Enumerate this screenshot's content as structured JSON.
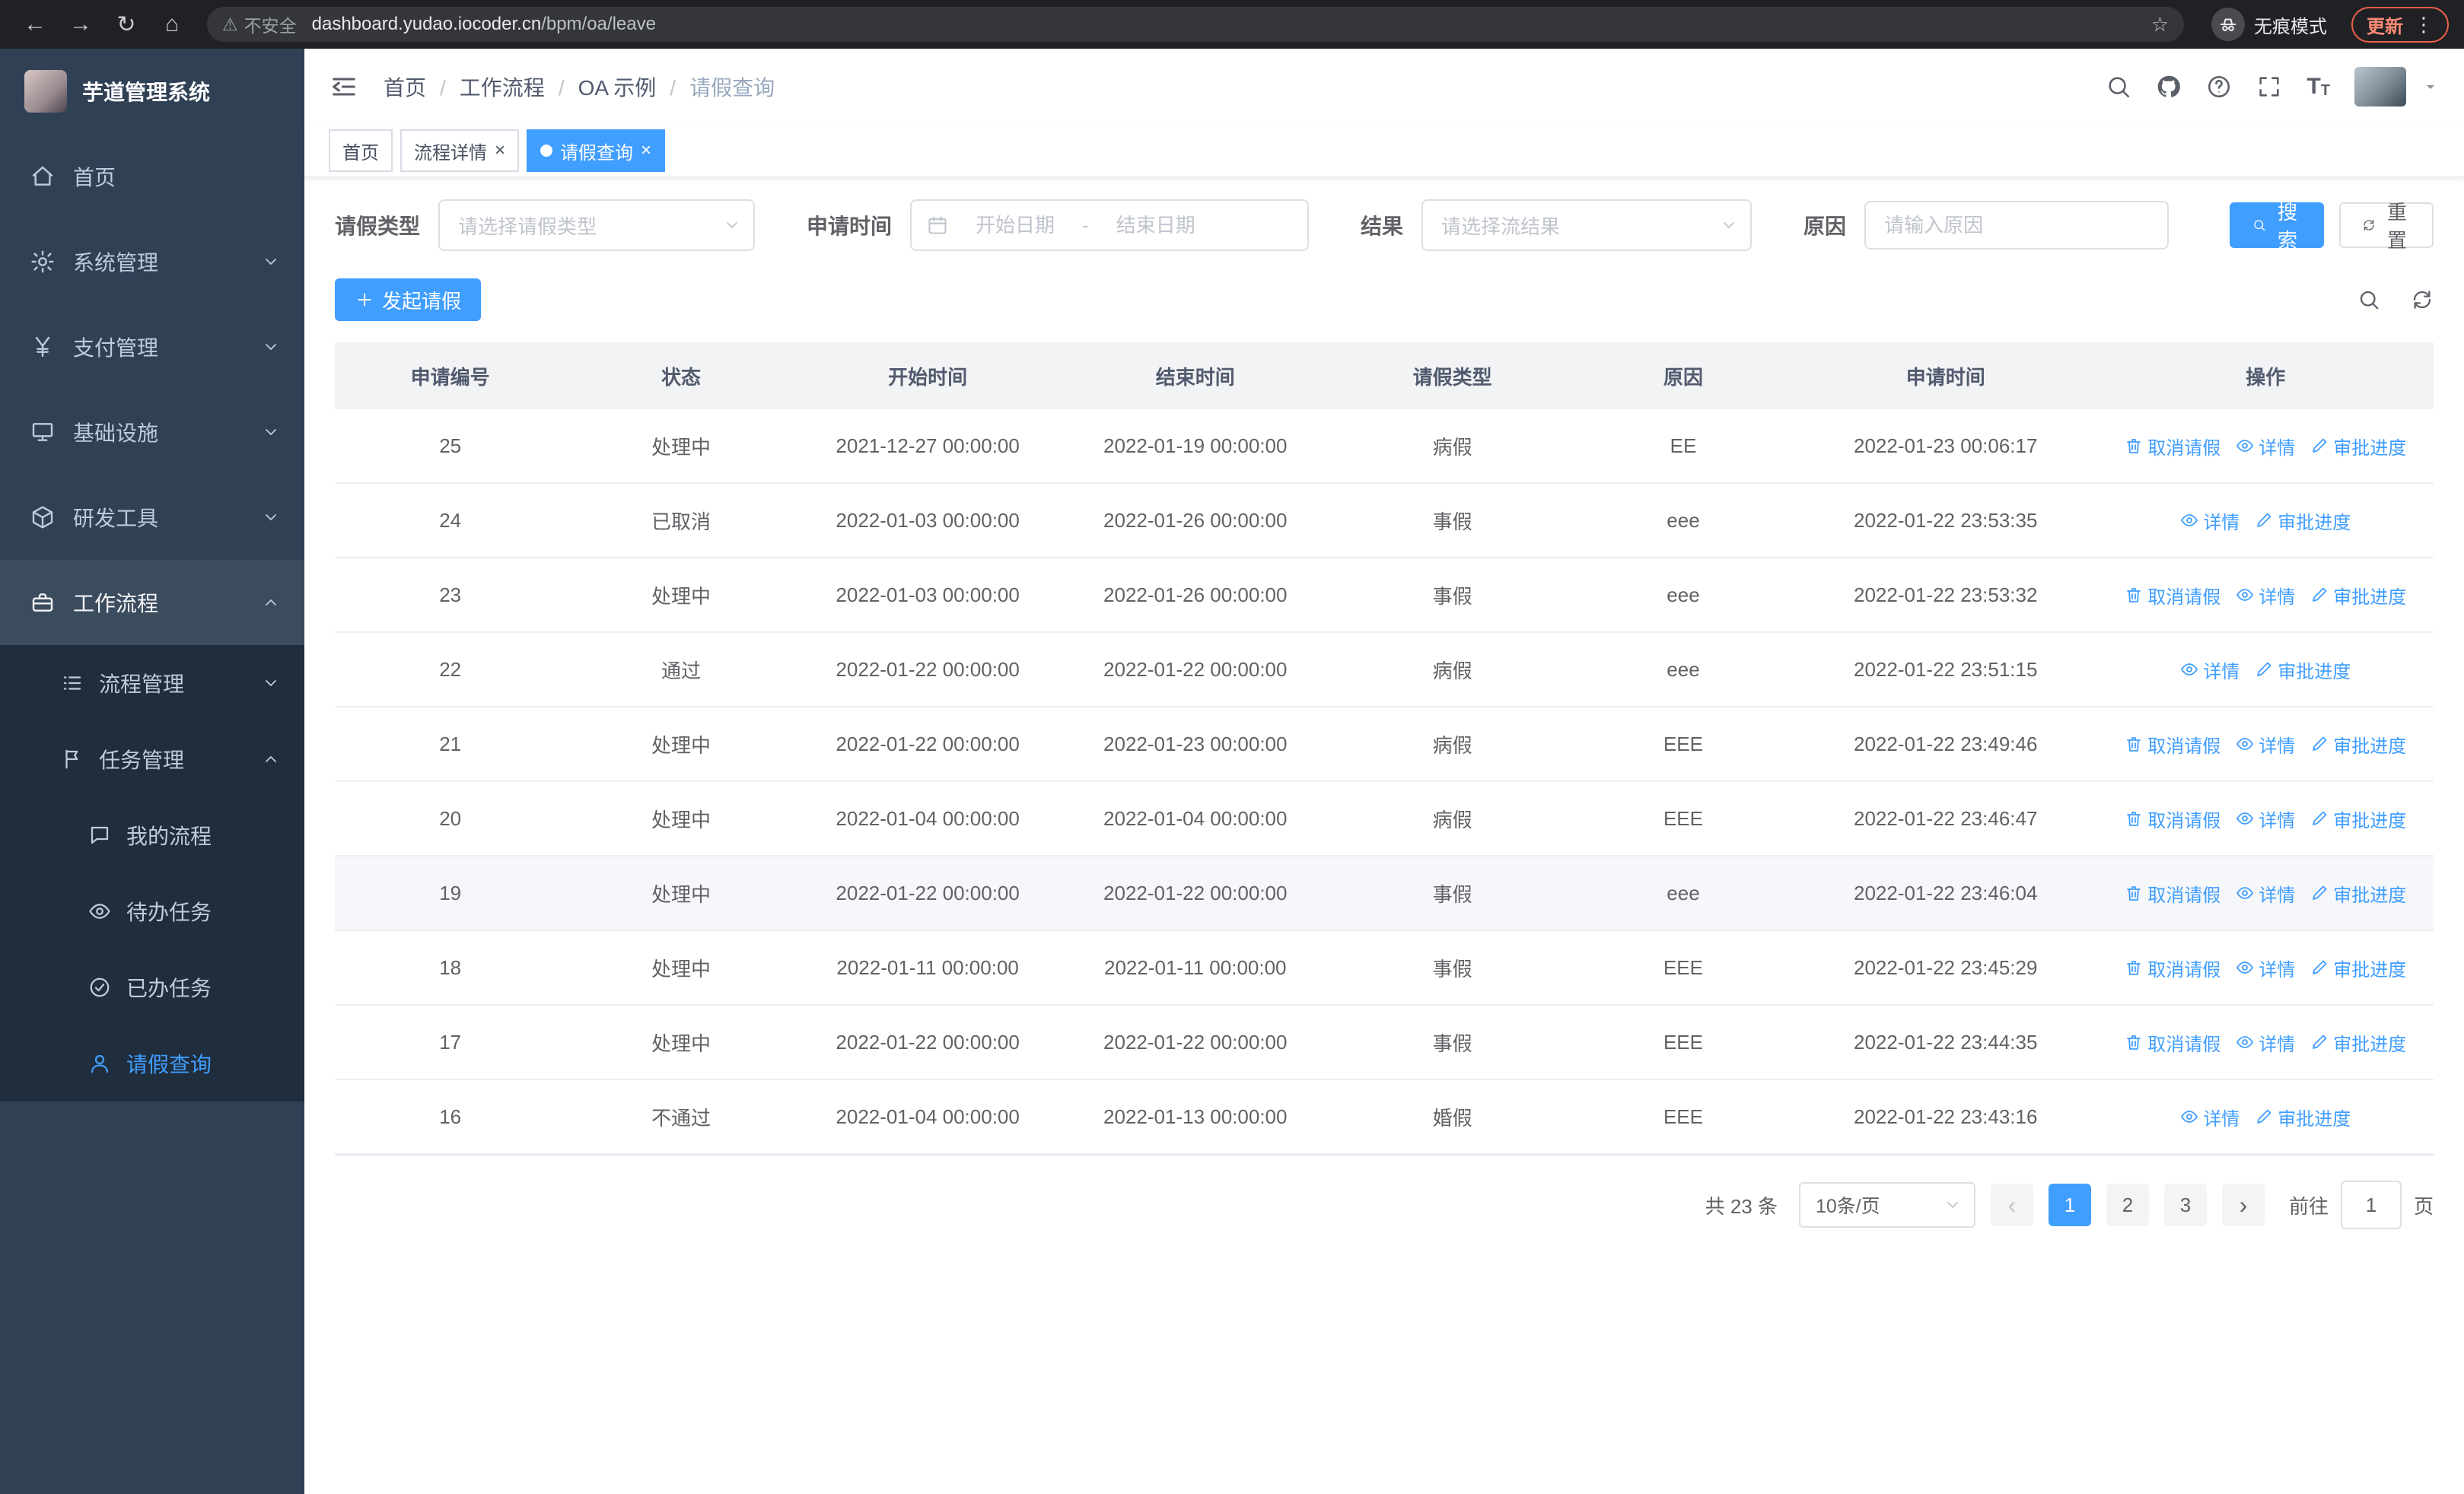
{
  "accent": "#409EFF",
  "browser": {
    "security_label": "不安全",
    "url_domain": "dashboard.yudao.iocoder.cn",
    "url_path": "/bpm/oa/leave",
    "incognito_label": "无痕模式",
    "update_label": "更新"
  },
  "sidebar": {
    "title": "芋道管理系统",
    "top_items": [
      {
        "label": "首页",
        "icon": "home",
        "chevron": false,
        "expanded": false,
        "active_section": false
      },
      {
        "label": "系统管理",
        "icon": "gear",
        "chevron": true,
        "expanded": false,
        "active_section": false
      },
      {
        "label": "支付管理",
        "icon": "yen",
        "chevron": true,
        "expanded": false,
        "active_section": false
      },
      {
        "label": "基础设施",
        "icon": "infra",
        "chevron": true,
        "expanded": false,
        "active_section": false
      },
      {
        "label": "研发工具",
        "icon": "tools",
        "chevron": true,
        "expanded": false,
        "active_section": false
      },
      {
        "label": "工作流程",
        "icon": "workflow",
        "chevron": true,
        "expanded": true,
        "active_section": true
      }
    ],
    "sub_items": [
      {
        "label": "流程管理",
        "icon": "list",
        "chevron": true,
        "expanded": false,
        "child": false,
        "active": false
      },
      {
        "label": "任务管理",
        "icon": "flag",
        "chevron": true,
        "expanded": true,
        "child": false,
        "active": false
      },
      {
        "label": "我的流程",
        "icon": "chat",
        "chevron": false,
        "child": true,
        "active": false
      },
      {
        "label": "待办任务",
        "icon": "eye",
        "chevron": false,
        "child": true,
        "active": false
      },
      {
        "label": "已办任务",
        "icon": "done",
        "chevron": false,
        "child": true,
        "active": false
      },
      {
        "label": "请假查询",
        "icon": "user",
        "chevron": false,
        "child": true,
        "active": true
      }
    ]
  },
  "topbar": {
    "breadcrumb": [
      {
        "label": "首页",
        "current": false
      },
      {
        "label": "工作流程",
        "current": false
      },
      {
        "label": "OA 示例",
        "current": false
      },
      {
        "label": "请假查询",
        "current": true
      }
    ]
  },
  "tabs": [
    {
      "label": "首页",
      "closable": false,
      "active": false
    },
    {
      "label": "流程详情",
      "closable": true,
      "active": false
    },
    {
      "label": "请假查询",
      "closable": true,
      "active": true
    }
  ],
  "filters": {
    "leave_type_label": "请假类型",
    "leave_type_placeholder": "请选择请假类型",
    "apply_time_label": "申请时间",
    "start_date_placeholder": "开始日期",
    "date_separator": "-",
    "end_date_placeholder": "结束日期",
    "result_label": "结果",
    "result_placeholder": "请选择流结果",
    "reason_label": "原因",
    "reason_placeholder": "请输入原因",
    "search_label": "搜索",
    "reset_label": "重置"
  },
  "toolbar": {
    "create_label": "发起请假"
  },
  "table": {
    "columns": [
      "申请编号",
      "状态",
      "开始时间",
      "结束时间",
      "请假类型",
      "原因",
      "申请时间",
      "操作"
    ],
    "action_labels": {
      "cancel": "取消请假",
      "detail": "详情",
      "progress": "审批进度"
    },
    "rows": [
      {
        "id": "25",
        "status": "处理中",
        "start": "2021-12-27 00:00:00",
        "end": "2022-01-19 00:00:00",
        "type": "病假",
        "reason": "EE",
        "time": "2022-01-23 00:06:17",
        "cancel": true,
        "hover": false
      },
      {
        "id": "24",
        "status": "已取消",
        "start": "2022-01-03 00:00:00",
        "end": "2022-01-26 00:00:00",
        "type": "事假",
        "reason": "eee",
        "time": "2022-01-22 23:53:35",
        "cancel": false,
        "hover": false
      },
      {
        "id": "23",
        "status": "处理中",
        "start": "2022-01-03 00:00:00",
        "end": "2022-01-26 00:00:00",
        "type": "事假",
        "reason": "eee",
        "time": "2022-01-22 23:53:32",
        "cancel": true,
        "hover": false
      },
      {
        "id": "22",
        "status": "通过",
        "start": "2022-01-22 00:00:00",
        "end": "2022-01-22 00:00:00",
        "type": "病假",
        "reason": "eee",
        "time": "2022-01-22 23:51:15",
        "cancel": false,
        "hover": false
      },
      {
        "id": "21",
        "status": "处理中",
        "start": "2022-01-22 00:00:00",
        "end": "2022-01-23 00:00:00",
        "type": "病假",
        "reason": "EEE",
        "time": "2022-01-22 23:49:46",
        "cancel": true,
        "hover": false
      },
      {
        "id": "20",
        "status": "处理中",
        "start": "2022-01-04 00:00:00",
        "end": "2022-01-04 00:00:00",
        "type": "病假",
        "reason": "EEE",
        "time": "2022-01-22 23:46:47",
        "cancel": true,
        "hover": false
      },
      {
        "id": "19",
        "status": "处理中",
        "start": "2022-01-22 00:00:00",
        "end": "2022-01-22 00:00:00",
        "type": "事假",
        "reason": "eee",
        "time": "2022-01-22 23:46:04",
        "cancel": true,
        "hover": true
      },
      {
        "id": "18",
        "status": "处理中",
        "start": "2022-01-11 00:00:00",
        "end": "2022-01-11 00:00:00",
        "type": "事假",
        "reason": "EEE",
        "time": "2022-01-22 23:45:29",
        "cancel": true,
        "hover": false
      },
      {
        "id": "17",
        "status": "处理中",
        "start": "2022-01-22 00:00:00",
        "end": "2022-01-22 00:00:00",
        "type": "事假",
        "reason": "EEE",
        "time": "2022-01-22 23:44:35",
        "cancel": true,
        "hover": false
      },
      {
        "id": "16",
        "status": "不通过",
        "start": "2022-01-04 00:00:00",
        "end": "2022-01-13 00:00:00",
        "type": "婚假",
        "reason": "EEE",
        "time": "2022-01-22 23:43:16",
        "cancel": false,
        "hover": false
      }
    ]
  },
  "pagination": {
    "total_label": "共 23 条",
    "page_size": "10条/页",
    "pages": [
      {
        "num": "1",
        "active": true
      },
      {
        "num": "2",
        "active": false
      },
      {
        "num": "3",
        "active": false
      }
    ],
    "goto_label": "前往",
    "goto_value": "1",
    "unit_label": "页"
  }
}
